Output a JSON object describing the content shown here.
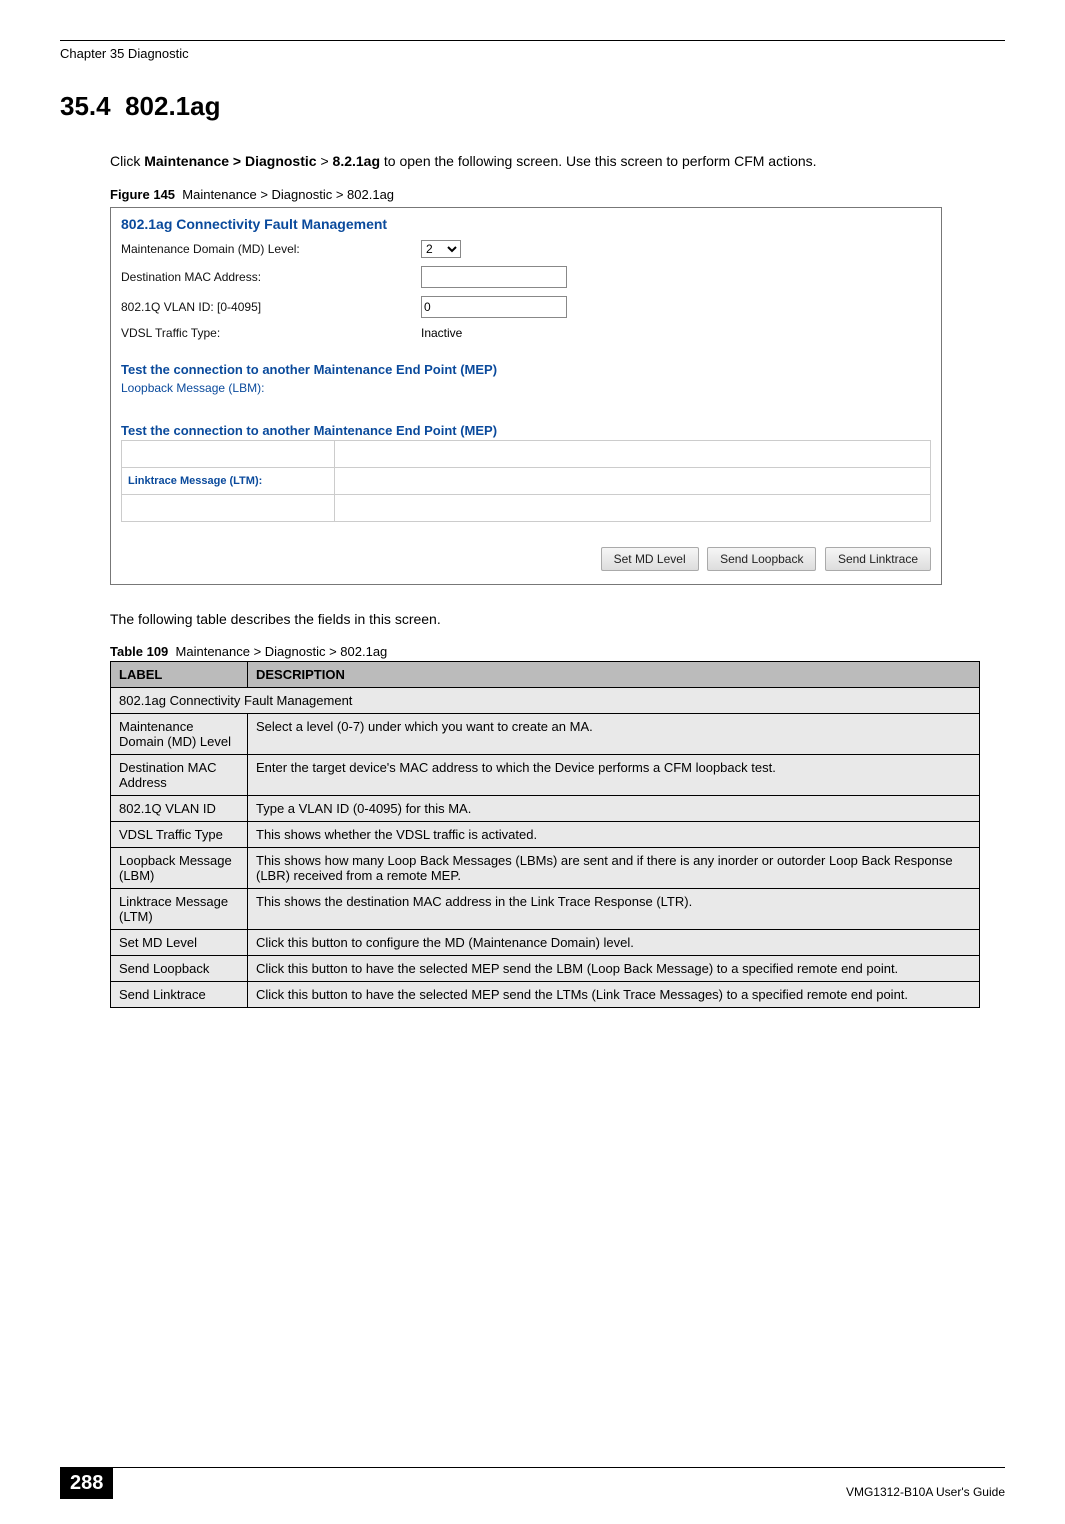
{
  "header": {
    "chapter": "Chapter 35 Diagnostic"
  },
  "section": {
    "number": "35.4",
    "title": "802.1ag"
  },
  "intro": {
    "prefix": "Click ",
    "bold1": "Maintenance > Diagnostic",
    "mid": " > ",
    "bold2": "8.2.1ag",
    "rest": " to open the following screen. Use this screen to perform CFM actions."
  },
  "figure": {
    "label": "Figure 145",
    "caption": "Maintenance > Diagnostic > 802.1ag",
    "panelTitle": "802.1ag Connectivity Fault Management",
    "rows": {
      "mdLevelLabel": "Maintenance Domain (MD) Level:",
      "mdLevelValue": "2",
      "destMacLabel": "Destination MAC Address:",
      "destMacValue": "",
      "vlanLabel": "802.1Q VLAN ID: [0-4095]",
      "vlanValue": "0",
      "vdslLabel": "VDSL Traffic Type:",
      "vdslValue": "Inactive"
    },
    "mepTest1": "Test the connection to another Maintenance End Point (MEP)",
    "lbm": "Loopback Message (LBM):",
    "mepTest2": "Test the connection to another Maintenance End Point (MEP)",
    "ltm": "Linktrace Message (LTM):",
    "buttons": {
      "setMd": "Set MD Level",
      "sendLoopback": "Send Loopback",
      "sendLinktrace": "Send Linktrace"
    }
  },
  "tableIntro": "The following table describes the fields in this screen.",
  "tableCaption": {
    "label": "Table 109",
    "text": "Maintenance > Diagnostic > 802.1ag"
  },
  "tableHeaders": {
    "label": "LABEL",
    "desc": "DESCRIPTION"
  },
  "tableRows": [
    {
      "label": "802.1ag Connectivity Fault Management",
      "desc": "",
      "span": true
    },
    {
      "label": "Maintenance Domain (MD) Level",
      "desc": "Select a level (0-7) under which you want to create an MA."
    },
    {
      "label": "Destination MAC Address",
      "desc": "Enter the target device's MAC address to which the Device performs a CFM loopback test."
    },
    {
      "label": "802.1Q VLAN ID",
      "desc": "Type a VLAN ID (0-4095) for this MA."
    },
    {
      "label": "VDSL Traffic Type",
      "desc": "This shows whether the VDSL traffic is activated."
    },
    {
      "label": "Loopback Message (LBM)",
      "desc": "This shows how many Loop Back Messages (LBMs) are sent and if there is any inorder or outorder Loop Back Response (LBR) received from a remote MEP."
    },
    {
      "label": "Linktrace Message (LTM)",
      "desc": "This shows the destination MAC address in the Link Trace Response (LTR)."
    },
    {
      "label": "Set MD Level",
      "desc": "Click this button to configure the MD (Maintenance Domain) level."
    },
    {
      "label": "Send Loopback",
      "desc": "Click this button to have the selected MEP send the LBM (Loop Back Message) to a specified remote end point."
    },
    {
      "label": "Send Linktrace",
      "desc": "Click this button to have the selected MEP send the LTMs (Link Trace Messages) to a specified remote end point."
    }
  ],
  "footer": {
    "pageNum": "288",
    "guide": "VMG1312-B10A User's Guide"
  }
}
